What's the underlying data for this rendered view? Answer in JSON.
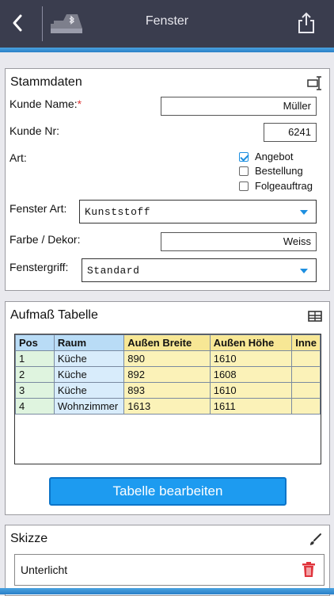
{
  "header": {
    "title": "Fenster"
  },
  "stammdaten": {
    "title": "Stammdaten",
    "kunde_name_label": "Kunde Name:",
    "required_mark": "*",
    "kunde_name_value": "Müller",
    "kunde_nr_label": "Kunde Nr:",
    "kunde_nr_value": "6241",
    "art_label": "Art:",
    "art_options": [
      {
        "label": "Angebot",
        "checked": true
      },
      {
        "label": "Bestellung",
        "checked": false
      },
      {
        "label": "Folgeauftrag",
        "checked": false
      }
    ],
    "fenster_art_label": "Fenster Art:",
    "fenster_art_value": "Kunststoff",
    "farbe_label": "Farbe / Dekor:",
    "farbe_value": "Weiss",
    "griff_label": "Fenstergriff:",
    "griff_value": "Standard"
  },
  "aufmass": {
    "title": "Aufmaß Tabelle",
    "columns": [
      "Pos",
      "Raum",
      "Außen Breite",
      "Außen Höhe",
      "Inne"
    ],
    "rows": [
      {
        "pos": "1",
        "raum": "Küche",
        "breite": "890",
        "hoehe": "1610"
      },
      {
        "pos": "2",
        "raum": "Küche",
        "breite": "892",
        "hoehe": "1608"
      },
      {
        "pos": "3",
        "raum": "Küche",
        "breite": "893",
        "hoehe": "1610"
      },
      {
        "pos": "4",
        "raum": " Wohnzimmer",
        "breite": "1613",
        "hoehe": "1611"
      }
    ],
    "button_label": "Tabelle bearbeiten"
  },
  "skizze": {
    "title": "Skizze",
    "item_label": "Unterlicht"
  },
  "colors": {
    "topbar": "#3a3d4e",
    "accent": "#1d9bf0",
    "delete": "#e0343c"
  }
}
